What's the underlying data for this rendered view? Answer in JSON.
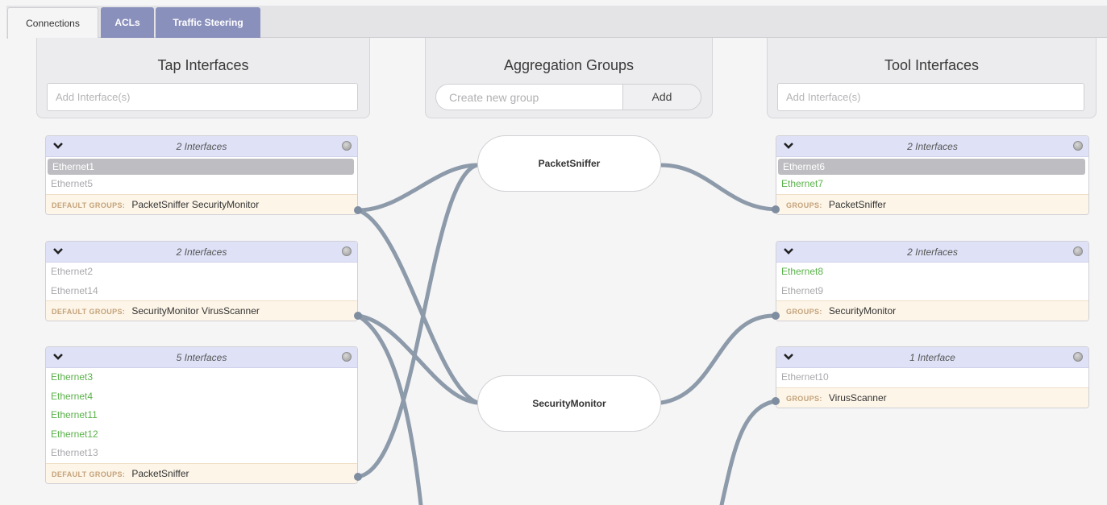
{
  "tabs": {
    "connections": "Connections",
    "acls": "ACLs",
    "traffic_steering": "Traffic Steering"
  },
  "tap": {
    "title": "Tap Interfaces",
    "placeholder": "Add Interface(s)"
  },
  "aggregation": {
    "title": "Aggregation Groups",
    "placeholder": "Create new group",
    "add_label": "Add"
  },
  "tool": {
    "title": "Tool Interfaces",
    "placeholder": "Add Interface(s)"
  },
  "tap_cards": [
    {
      "count": "2 Interfaces",
      "interfaces": [
        "Ethernet1",
        "Ethernet5"
      ],
      "groups_label": "DEFAULT GROUPS:",
      "groups": "PacketSniffer SecurityMonitor"
    },
    {
      "count": "2 Interfaces",
      "interfaces": [
        "Ethernet2",
        "Ethernet14"
      ],
      "groups_label": "DEFAULT GROUPS:",
      "groups": "SecurityMonitor VirusScanner"
    },
    {
      "count": "5 Interfaces",
      "interfaces": [
        "Ethernet3",
        "Ethernet4",
        "Ethernet11",
        "Ethernet12",
        "Ethernet13"
      ],
      "groups_label": "DEFAULT GROUPS:",
      "groups": "PacketSniffer"
    }
  ],
  "tool_cards": [
    {
      "count": "2 Interfaces",
      "interfaces": [
        "Ethernet6",
        "Ethernet7"
      ],
      "groups_label": "GROUPS:",
      "groups": "PacketSniffer"
    },
    {
      "count": "2 Interfaces",
      "interfaces": [
        "Ethernet8",
        "Ethernet9"
      ],
      "groups_label": "GROUPS:",
      "groups": "SecurityMonitor"
    },
    {
      "count": "1 Interface",
      "interfaces": [
        "Ethernet10"
      ],
      "groups_label": "GROUPS:",
      "groups": "VirusScanner"
    }
  ],
  "groups": {
    "packet_sniffer": "PacketSniffer",
    "security_monitor": "SecurityMonitor"
  },
  "colors": {
    "tab_active_bg": "#8a90bc",
    "card_head": "#dfe2f7",
    "footer": "#fdf5e8",
    "wire": "#8d9aaa",
    "interface_active": "#5ab24a",
    "interface_inactive": "#a9a9ad"
  }
}
